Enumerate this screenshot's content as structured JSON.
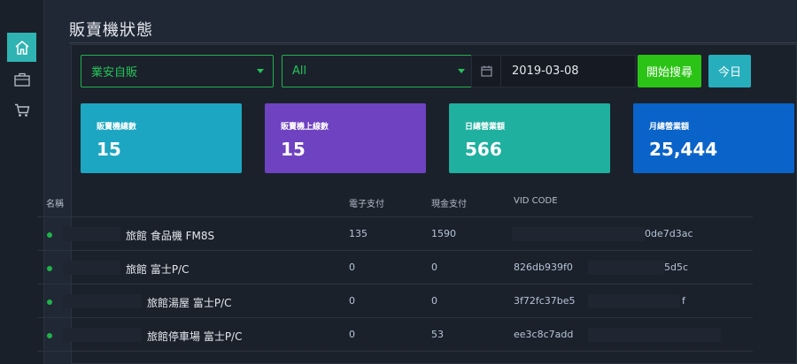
{
  "sidebar": {
    "items": [
      {
        "icon": "home-icon",
        "active": true
      },
      {
        "icon": "briefcase-icon",
        "active": false
      },
      {
        "icon": "cart-icon",
        "active": false
      }
    ]
  },
  "page": {
    "title": "販賣機狀態"
  },
  "filters": {
    "company": "業安自販",
    "scope": "All",
    "date": "2019-03-08",
    "search_label": "開始搜尋",
    "today_label": "今日"
  },
  "cards": [
    {
      "label": "販賣機總數",
      "value": "15",
      "color": "#1ca6c1"
    },
    {
      "label": "販賣機上線數",
      "value": "15",
      "color": "#6e42c1"
    },
    {
      "label": "日總營業額",
      "value": "566",
      "color": "#20b0a0"
    },
    {
      "label": "月總營業額",
      "value": "25,444",
      "color": "#0a63c9"
    }
  ],
  "table": {
    "headers": [
      "名稱",
      "電子支付",
      "現金支付",
      "VID CODE"
    ],
    "rows": [
      {
        "name": "旅館 食品機 FM8S",
        "electronic": "135",
        "cash": "1590",
        "vid_start": "",
        "vid_end": "0de7d3ac"
      },
      {
        "name": "旅館 富士P/C",
        "electronic": "0",
        "cash": "0",
        "vid_start": "826db939f0",
        "vid_end": "5d5c"
      },
      {
        "name": "旅館湯屋 富士P/C",
        "electronic": "0",
        "cash": "0",
        "vid_start": "3f72fc37be5",
        "vid_end": "f"
      },
      {
        "name": "旅館停車場 富士P/C",
        "electronic": "0",
        "cash": "53",
        "vid_start": "ee3c8c7add",
        "vid_end": ""
      }
    ]
  }
}
